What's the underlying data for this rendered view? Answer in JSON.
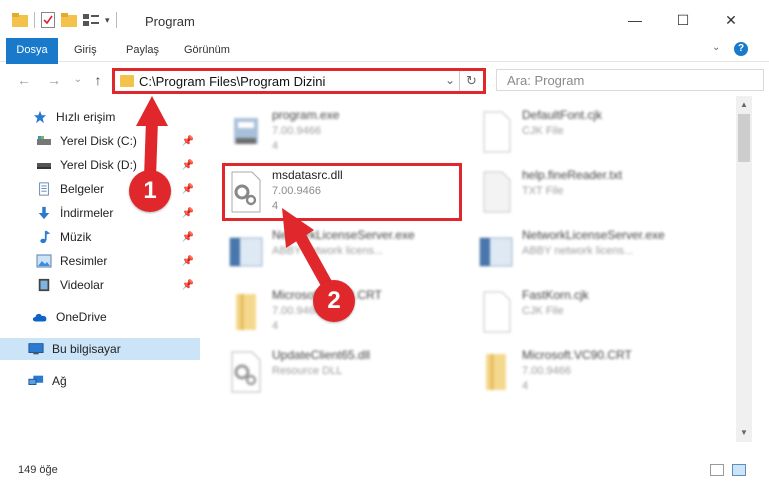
{
  "window": {
    "title": "Program",
    "minimize": "—",
    "maximize": "☐",
    "close": "✕"
  },
  "ribbon": {
    "tabs": [
      {
        "label": "Dosya"
      },
      {
        "label": "Giriş"
      },
      {
        "label": "Paylaş"
      },
      {
        "label": "Görünüm"
      }
    ],
    "help": "?"
  },
  "nav": {
    "back": "←",
    "forward": "→",
    "history": "⌄",
    "up": "↑",
    "address": "C:\\Program Files\\Program Dizini",
    "address_dropdown": "⌄",
    "refresh": "↻",
    "search_placeholder": "Ara: Program"
  },
  "sidebar": {
    "items": [
      {
        "label": "Hızlı erişim",
        "icon": "star-icon"
      },
      {
        "label": "Yerel Disk (C:)",
        "icon": "drive-icon",
        "pinned": true
      },
      {
        "label": "Yerel Disk (D:)",
        "icon": "drive-icon",
        "pinned": true
      },
      {
        "label": "Belgeler",
        "icon": "documents-icon",
        "pinned": true
      },
      {
        "label": "İndirmeler",
        "icon": "download-icon",
        "pinned": true
      },
      {
        "label": "Müzik",
        "icon": "music-icon",
        "pinned": true
      },
      {
        "label": "Resimler",
        "icon": "pictures-icon",
        "pinned": true
      },
      {
        "label": "Videolar",
        "icon": "videos-icon",
        "pinned": true
      },
      {
        "label": "OneDrive",
        "icon": "cloud-icon"
      },
      {
        "label": "Bu bilgisayar",
        "icon": "computer-icon",
        "selected": true
      },
      {
        "label": "Ağ",
        "icon": "network-icon"
      }
    ]
  },
  "files": [
    {
      "name": "program.exe",
      "line1": "7.00.9466",
      "line2": "4",
      "kind": "exe"
    },
    {
      "name": "DefaultFont.cjk",
      "line1": "CJK File",
      "line2": "",
      "kind": "doc"
    },
    {
      "name": "msdatasrc.dll",
      "line1": "7.00.9466",
      "line2": "4",
      "kind": "dll"
    },
    {
      "name": "help.fineReader.txt",
      "line1": "TXT File",
      "line2": "",
      "kind": "doc"
    },
    {
      "name": "NetworkLicenseServer.exe",
      "line1": "ABBY network licens...",
      "line2": "",
      "kind": "app"
    },
    {
      "name": "NetworkLicenseServer.exe",
      "line1": "ABBY network licens...",
      "line2": "",
      "kind": "app"
    },
    {
      "name": "Microsoft.VC90.CRT",
      "line1": "7.00.9466",
      "line2": "4",
      "kind": "folder"
    },
    {
      "name": "FastKorn.cjk",
      "line1": "CJK File",
      "line2": "",
      "kind": "doc"
    },
    {
      "name": "UpdateClient65.dll",
      "line1": "Resource DLL",
      "line2": "",
      "kind": "dll"
    },
    {
      "name": "Microsoft.VC90.CRT",
      "line1": "7.00.9466",
      "line2": "4",
      "kind": "folder"
    }
  ],
  "status": {
    "count": "149 öğe"
  },
  "annotations": {
    "step1": "1",
    "step2": "2",
    "color": "#e0272b"
  }
}
